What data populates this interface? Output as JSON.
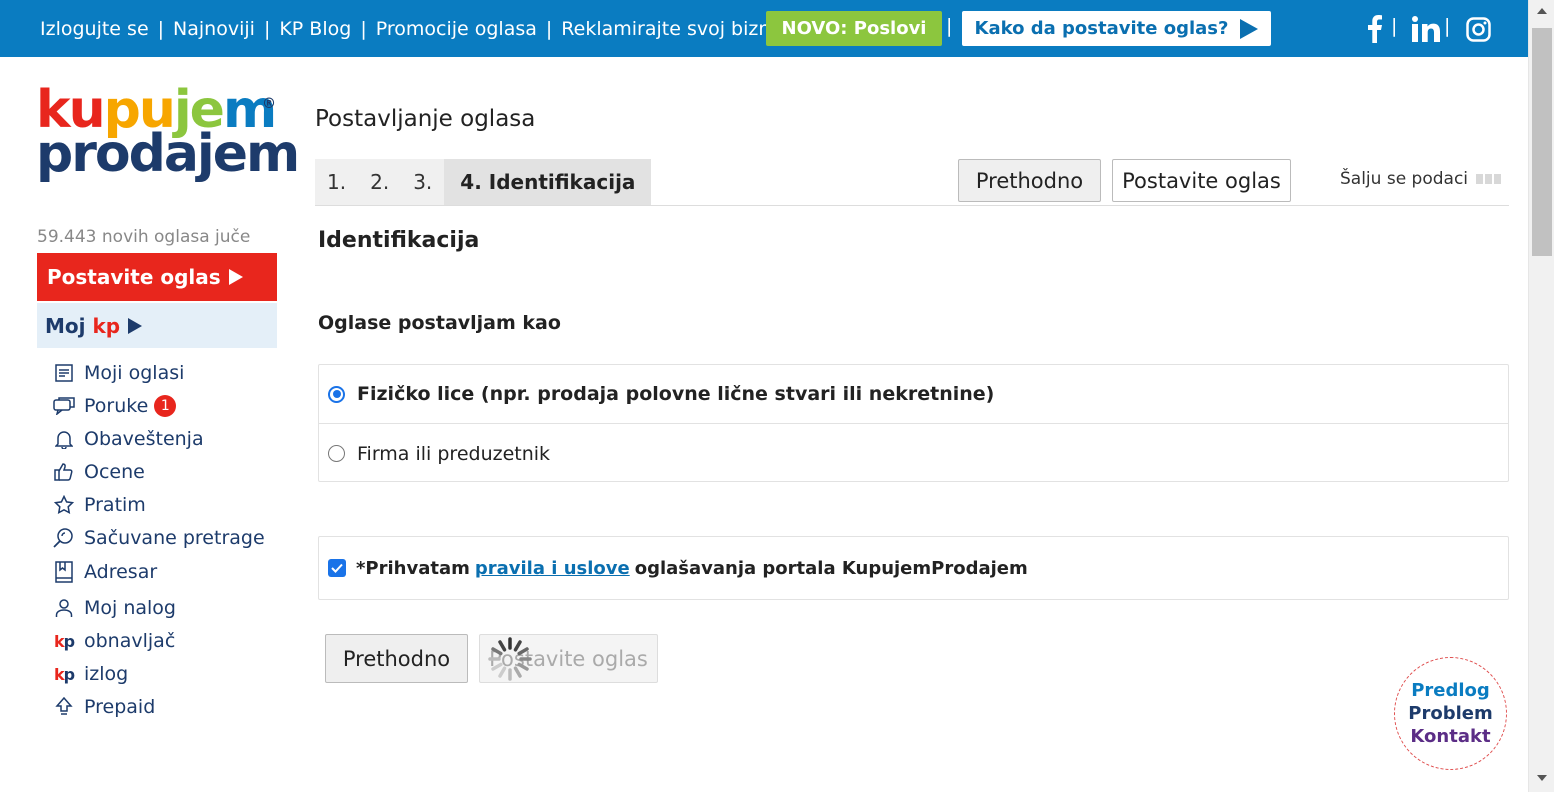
{
  "topbar": {
    "links": [
      "Izlogujte se",
      "Najnoviji",
      "KP Blog",
      "Promocije oglasa",
      "Reklamirajte svoj biznis"
    ],
    "novo_label": "NOVO: Poslovi",
    "howto_label": "Kako da postavite oglas?",
    "social_icons": [
      "facebook-icon",
      "linkedin-icon",
      "instagram-icon"
    ],
    "color": "#0a7cc1"
  },
  "logo": {
    "line1": [
      "ku",
      "pu",
      "je",
      "m"
    ],
    "line1_colors": [
      "#e8261d",
      "#f7a600",
      "#8cc63e",
      "#0a7cc1"
    ],
    "line2": "prodajem",
    "reg": "®"
  },
  "sidebar": {
    "new_ads": "59.443 novih oglasa juče",
    "post_button": "Postavite oglas",
    "moj_label": "Moj",
    "moj_kp": "kp",
    "items": [
      {
        "label": "Moji oglasi",
        "icon": "list-icon"
      },
      {
        "label": "Poruke",
        "icon": "chat-icon",
        "badge": "1"
      },
      {
        "label": "Obaveštenja",
        "icon": "bell-icon"
      },
      {
        "label": "Ocene",
        "icon": "thumbs-up-icon"
      },
      {
        "label": "Pratim",
        "icon": "star-icon"
      },
      {
        "label": "Sačuvane pretrage",
        "icon": "search-bell-icon"
      },
      {
        "label": "Adresar",
        "icon": "address-book-icon"
      },
      {
        "label": "Moj nalog",
        "icon": "user-icon"
      },
      {
        "label": "obnavljač",
        "icon": "kp-icon"
      },
      {
        "label": "izlog",
        "icon": "kp-icon"
      },
      {
        "label": "Prepaid",
        "icon": "upload-arrow-icon"
      }
    ],
    "kp_k": "k",
    "kp_p": "p"
  },
  "main": {
    "title": "Postavljanje oglasa",
    "steps": [
      "1.",
      "2.",
      "3.",
      "4. Identifikacija"
    ],
    "prev_label": "Prethodno",
    "post_label": "Postavite oglas",
    "sending_label": "Šalju se podaci",
    "section_title": "Identifikacija",
    "posting_as_label": "Oglase postavljam kao",
    "options": [
      {
        "label": "Fizičko lice (npr. prodaja polovne lične stvari ili nekretnine)",
        "checked": true
      },
      {
        "label": "Firma ili preduzetnik",
        "checked": false
      }
    ],
    "terms_prefix": "*Prihvatam",
    "terms_link": "pravila i uslove",
    "terms_suffix": "oglašavanja portala KupujemProdajem",
    "terms_checked": true
  },
  "feedback": {
    "line1": "Predlog",
    "line2": "Problem",
    "line3": "Kontakt"
  }
}
